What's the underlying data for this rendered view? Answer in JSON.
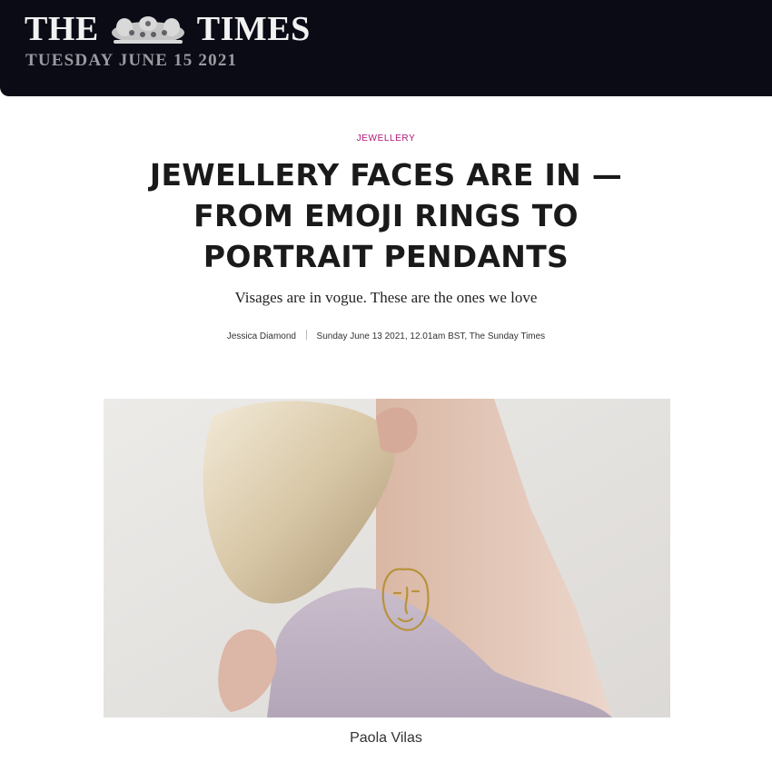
{
  "masthead": {
    "brand_left": "THE",
    "brand_right": "TIMES",
    "date": "TUESDAY JUNE 15 2021",
    "crest_icon": "royal-crest-icon",
    "background_color": "#0b0b16"
  },
  "article": {
    "section": "JEWELLERY",
    "section_color": "#b0157a",
    "headline_line1": "JEWELLERY FACES ARE IN —",
    "headline_line2": "FROM EMOJI RINGS TO",
    "headline_line3": "PORTRAIT PENDANTS",
    "standfirst": "Visages are in vogue. These are the ones we love",
    "author": "Jessica Diamond",
    "dateline": "Sunday June 13 2021, 12.01am BST, The Sunday Times"
  },
  "image": {
    "caption": "Paola Vilas"
  }
}
